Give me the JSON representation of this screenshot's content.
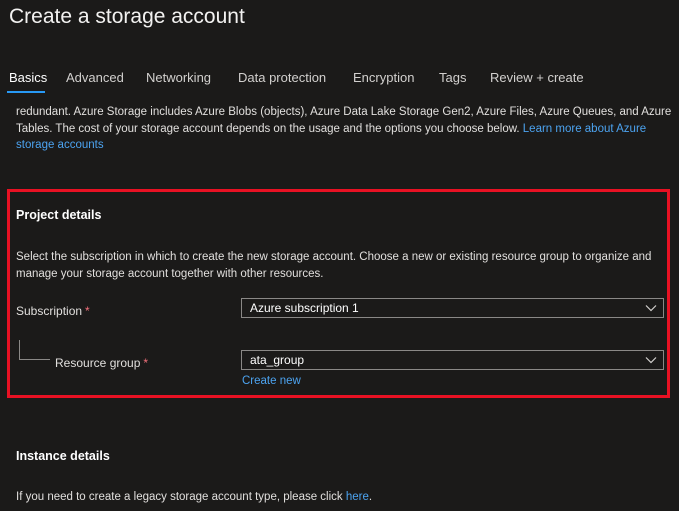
{
  "page": {
    "title": "Create a storage account"
  },
  "tabs": [
    {
      "label": "Basics",
      "active": true
    },
    {
      "label": "Advanced",
      "active": false
    },
    {
      "label": "Networking",
      "active": false
    },
    {
      "label": "Data protection",
      "active": false
    },
    {
      "label": "Encryption",
      "active": false
    },
    {
      "label": "Tags",
      "active": false
    },
    {
      "label": "Review + create",
      "active": false
    }
  ],
  "intro": {
    "line1": "redundant. Azure Storage includes Azure Blobs (objects), Azure Data Lake Storage Gen2, Azure Files, Azure Queues, and Azure",
    "line2_text": "Tables. The cost of your storage account depends on the usage and the options you choose below. ",
    "line2_link": "Learn more about Azure",
    "line3_link": "storage accounts"
  },
  "project_details": {
    "heading": "Project details",
    "desc_line1": "Select the subscription in which to create the new storage account. Choose a new or existing resource group to organize and",
    "desc_line2": "manage your storage account together with other resources.",
    "subscription": {
      "label": "Subscription",
      "required_mark": "*",
      "value": "Azure subscription 1"
    },
    "resource_group": {
      "label": "Resource group",
      "required_mark": "*",
      "value": "ata_group",
      "create_new_label": "Create new"
    }
  },
  "instance_details": {
    "heading": "Instance details",
    "legacy_text": "If you need to create a legacy storage account type, please click ",
    "legacy_link": "here",
    "legacy_end": "."
  },
  "colors": {
    "background": "#1b1a19",
    "link": "#4ca3f0",
    "highlight": "#e81123",
    "tab_accent": "#2899f5",
    "required": "#f1707b"
  },
  "icons": {
    "select_chevron": "chevron-down-icon"
  }
}
